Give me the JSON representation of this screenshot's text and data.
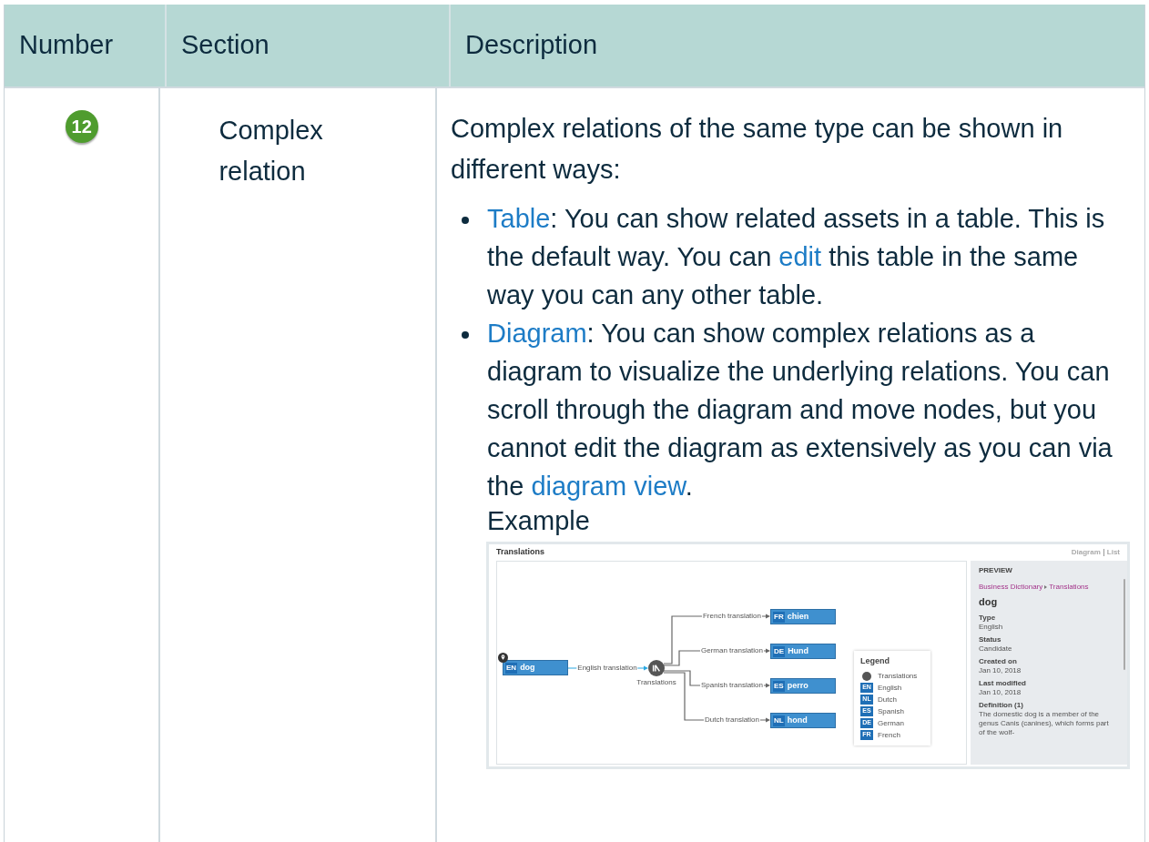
{
  "table": {
    "columns": [
      "Number",
      "Section",
      "Description"
    ],
    "rows": [
      {
        "number": "12",
        "section": "Complex relation",
        "description": {
          "intro": "Complex relations of the same type can be shown in different ways:",
          "bullets": [
            [
              {
                "kind": "link",
                "text": "Table"
              },
              {
                "kind": "text",
                "text": ": You can show related assets in a table. This is the default way. You can "
              },
              {
                "kind": "link",
                "text": "edit"
              },
              {
                "kind": "text",
                "text": " this table in the same way you can any other table."
              }
            ],
            [
              {
                "kind": "link",
                "text": "Diagram"
              },
              {
                "kind": "text",
                "text": ": You can show complex relations as a diagram to visualize the underlying relations. You can scroll through the diagram and move nodes, but you cannot edit the diagram as extensively as you can via the "
              },
              {
                "kind": "link",
                "text": "diagram view"
              },
              {
                "kind": "text",
                "text": "."
              }
            ]
          ],
          "example_label": "Example",
          "example": {
            "title": "Translations",
            "view_switch": [
              {
                "label": "Diagram",
                "selected": false
              },
              {
                "label": "List",
                "selected": false
              }
            ],
            "source": {
              "code": "EN",
              "label": "dog"
            },
            "source_edge": "English translation",
            "hub": "Translations",
            "targets": [
              {
                "code": "FR",
                "label": "chien",
                "edge": "French translation"
              },
              {
                "code": "DE",
                "label": "Hund",
                "edge": "German translation"
              },
              {
                "code": "ES",
                "label": "perro",
                "edge": "Spanish translation"
              },
              {
                "code": "NL",
                "label": "hond",
                "edge": "Dutch translation"
              }
            ],
            "legend": {
              "title": "Legend",
              "items": [
                {
                  "kind": "hub",
                  "label": "Translations"
                },
                {
                  "kind": "badge",
                  "code": "EN",
                  "label": "English"
                },
                {
                  "kind": "badge",
                  "code": "NL",
                  "label": "Dutch"
                },
                {
                  "kind": "badge",
                  "code": "ES",
                  "label": "Spanish"
                },
                {
                  "kind": "badge",
                  "code": "DE",
                  "label": "German"
                },
                {
                  "kind": "badge",
                  "code": "FR",
                  "label": "French"
                }
              ]
            },
            "preview": {
              "heading": "PREVIEW",
              "breadcrumb": [
                "Business Dictionary",
                "Translations"
              ],
              "title": "dog",
              "fields": [
                {
                  "label": "Type",
                  "value": "English"
                },
                {
                  "label": "Status",
                  "value": "Candidate"
                },
                {
                  "label": "Created on",
                  "value": "Jan 10, 2018"
                },
                {
                  "label": "Last modified",
                  "value": "Jan 10, 2018"
                },
                {
                  "label": "Definition (1)",
                  "value": "The domestic dog is a member of the genus Canis (canines), which forms part of the wolf-"
                }
              ]
            }
          }
        }
      }
    ]
  }
}
